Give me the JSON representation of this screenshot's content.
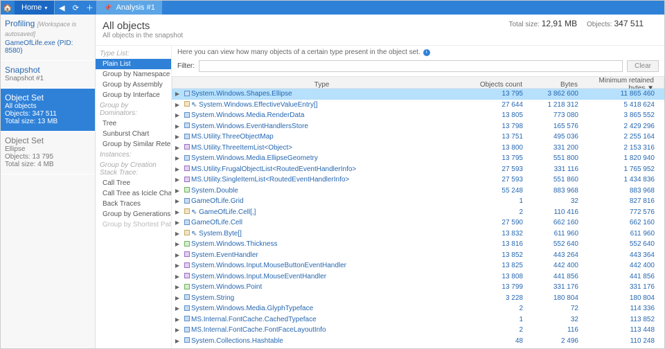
{
  "topbar": {
    "home_label": "Home",
    "tab_label": "Analysis #1"
  },
  "sidebar": {
    "profiling": {
      "title": "Profiling",
      "hint": "[Workspace is autosaved]",
      "sub": "GameOfLife.exe (PID: 8580)"
    },
    "snapshot": {
      "title": "Snapshot",
      "sub": "Snapshot #1"
    },
    "objset_active": {
      "title": "Object Set",
      "l1": "All objects",
      "l2": "Objects: 347 511",
      "l3": "Total size: 13 MB"
    },
    "objset2": {
      "title": "Object Set",
      "l1": "Ellipse",
      "l2": "Objects: 13 795",
      "l3": "Total size: 4 MB"
    }
  },
  "header": {
    "title": "All objects",
    "subtitle": "All objects in the snapshot",
    "stats_total_label": "Total size:",
    "stats_total_value": "12,91 MB",
    "stats_objects_label": "Objects:",
    "stats_objects_value": "347 511"
  },
  "typelist": {
    "groups": [
      {
        "header": "Type List:",
        "items": [
          {
            "label": "Plain List",
            "active": true
          },
          {
            "label": "Group by Namespace"
          },
          {
            "label": "Group by Assembly"
          },
          {
            "label": "Group by Interface"
          }
        ]
      },
      {
        "header": "Group by Dominators:",
        "items": [
          {
            "label": "Tree"
          },
          {
            "label": "Sunburst Chart"
          }
        ]
      },
      {
        "header": "",
        "items": [
          {
            "label": "Group by Similar Retention"
          }
        ]
      },
      {
        "header": "Instances:",
        "items": []
      },
      {
        "header": "Group by Creation Stack Trace:",
        "items": [
          {
            "label": "Call Tree"
          },
          {
            "label": "Call Tree as Icicle Chart"
          },
          {
            "label": "Back Traces"
          }
        ]
      },
      {
        "header": "",
        "items": [
          {
            "label": "Group by Generations"
          }
        ]
      },
      {
        "header": "",
        "items": [
          {
            "label": "Group by Shortest Path",
            "disabled": true
          }
        ]
      }
    ]
  },
  "info_text": "Here you can view how many objects of a certain type present in the object set.",
  "filter": {
    "label": "Filter:",
    "placeholder": "",
    "clear": "Clear"
  },
  "columns": {
    "type": "Type",
    "count": "Objects count",
    "bytes": "Bytes",
    "retained": "Minimum retained bytes ▼"
  },
  "rows": [
    {
      "icon": "blue",
      "name": "System.Windows.Shapes.Ellipse",
      "count": "13 795",
      "bytes": "3 862 600",
      "retained": "11 865 460",
      "selected": true
    },
    {
      "icon": "tan",
      "prefix": "⇖ ",
      "name": "System.Windows.EffectiveValueEntry[]",
      "count": "27 644",
      "bytes": "1 218 312",
      "retained": "5 418 624"
    },
    {
      "icon": "blue",
      "name": "System.Windows.Media.RenderData",
      "count": "13 805",
      "bytes": "773 080",
      "retained": "3 865 552"
    },
    {
      "icon": "blue",
      "name": "System.Windows.EventHandlersStore",
      "count": "13 798",
      "bytes": "165 576",
      "retained": "2 429 296"
    },
    {
      "icon": "blue",
      "name": "MS.Utility.ThreeObjectMap",
      "count": "13 751",
      "bytes": "495 036",
      "retained": "2 255 164"
    },
    {
      "icon": "purple",
      "name": "MS.Utility.ThreeItemList<Object>",
      "count": "13 800",
      "bytes": "331 200",
      "retained": "2 153 316"
    },
    {
      "icon": "blue",
      "name": "System.Windows.Media.EllipseGeometry",
      "count": "13 795",
      "bytes": "551 800",
      "retained": "1 820 940"
    },
    {
      "icon": "purple",
      "name": "MS.Utility.FrugalObjectList<RoutedEventHandlerInfo>",
      "count": "27 593",
      "bytes": "331 116",
      "retained": "1 765 952"
    },
    {
      "icon": "purple",
      "name": "MS.Utility.SingleItemList<RoutedEventHandlerInfo>",
      "count": "27 593",
      "bytes": "551 860",
      "retained": "1 434 836"
    },
    {
      "icon": "green",
      "name": "System.Double",
      "count": "55 248",
      "bytes": "883 968",
      "retained": "883 968"
    },
    {
      "icon": "blue",
      "name": "GameOfLife.Grid",
      "count": "1",
      "bytes": "32",
      "retained": "827 816"
    },
    {
      "icon": "tan",
      "prefix": "⇖ ",
      "name": "GameOfLife.Cell[,]",
      "count": "2",
      "bytes": "110 416",
      "retained": "772 576"
    },
    {
      "icon": "blue",
      "name": "GameOfLife.Cell",
      "count": "27 590",
      "bytes": "662 160",
      "retained": "662 160"
    },
    {
      "icon": "tan",
      "prefix": "⇖ ",
      "name": "System.Byte[]",
      "count": "13 832",
      "bytes": "611 960",
      "retained": "611 960"
    },
    {
      "icon": "green",
      "name": "System.Windows.Thickness",
      "count": "13 816",
      "bytes": "552 640",
      "retained": "552 640"
    },
    {
      "icon": "purple",
      "name": "System.EventHandler",
      "count": "13 852",
      "bytes": "443 264",
      "retained": "443 364"
    },
    {
      "icon": "purple",
      "name": "System.Windows.Input.MouseButtonEventHandler",
      "count": "13 825",
      "bytes": "442 400",
      "retained": "442 400"
    },
    {
      "icon": "purple",
      "name": "System.Windows.Input.MouseEventHandler",
      "count": "13 808",
      "bytes": "441 856",
      "retained": "441 856"
    },
    {
      "icon": "green",
      "name": "System.Windows.Point",
      "count": "13 799",
      "bytes": "331 176",
      "retained": "331 176"
    },
    {
      "icon": "blue",
      "name": "System.String",
      "count": "3 228",
      "bytes": "180 804",
      "retained": "180 804"
    },
    {
      "icon": "blue",
      "name": "System.Windows.Media.GlyphTypeface",
      "count": "2",
      "bytes": "72",
      "retained": "114 336"
    },
    {
      "icon": "blue",
      "name": "MS.Internal.FontCache.CachedTypeface",
      "count": "1",
      "bytes": "32",
      "retained": "113 852"
    },
    {
      "icon": "blue",
      "name": "MS.Internal.FontCache.FontFaceLayoutInfo",
      "count": "2",
      "bytes": "116",
      "retained": "113 448"
    },
    {
      "icon": "blue",
      "name": "System.Collections.Hashtable",
      "count": "48",
      "bytes": "2 496",
      "retained": "110 248"
    }
  ]
}
